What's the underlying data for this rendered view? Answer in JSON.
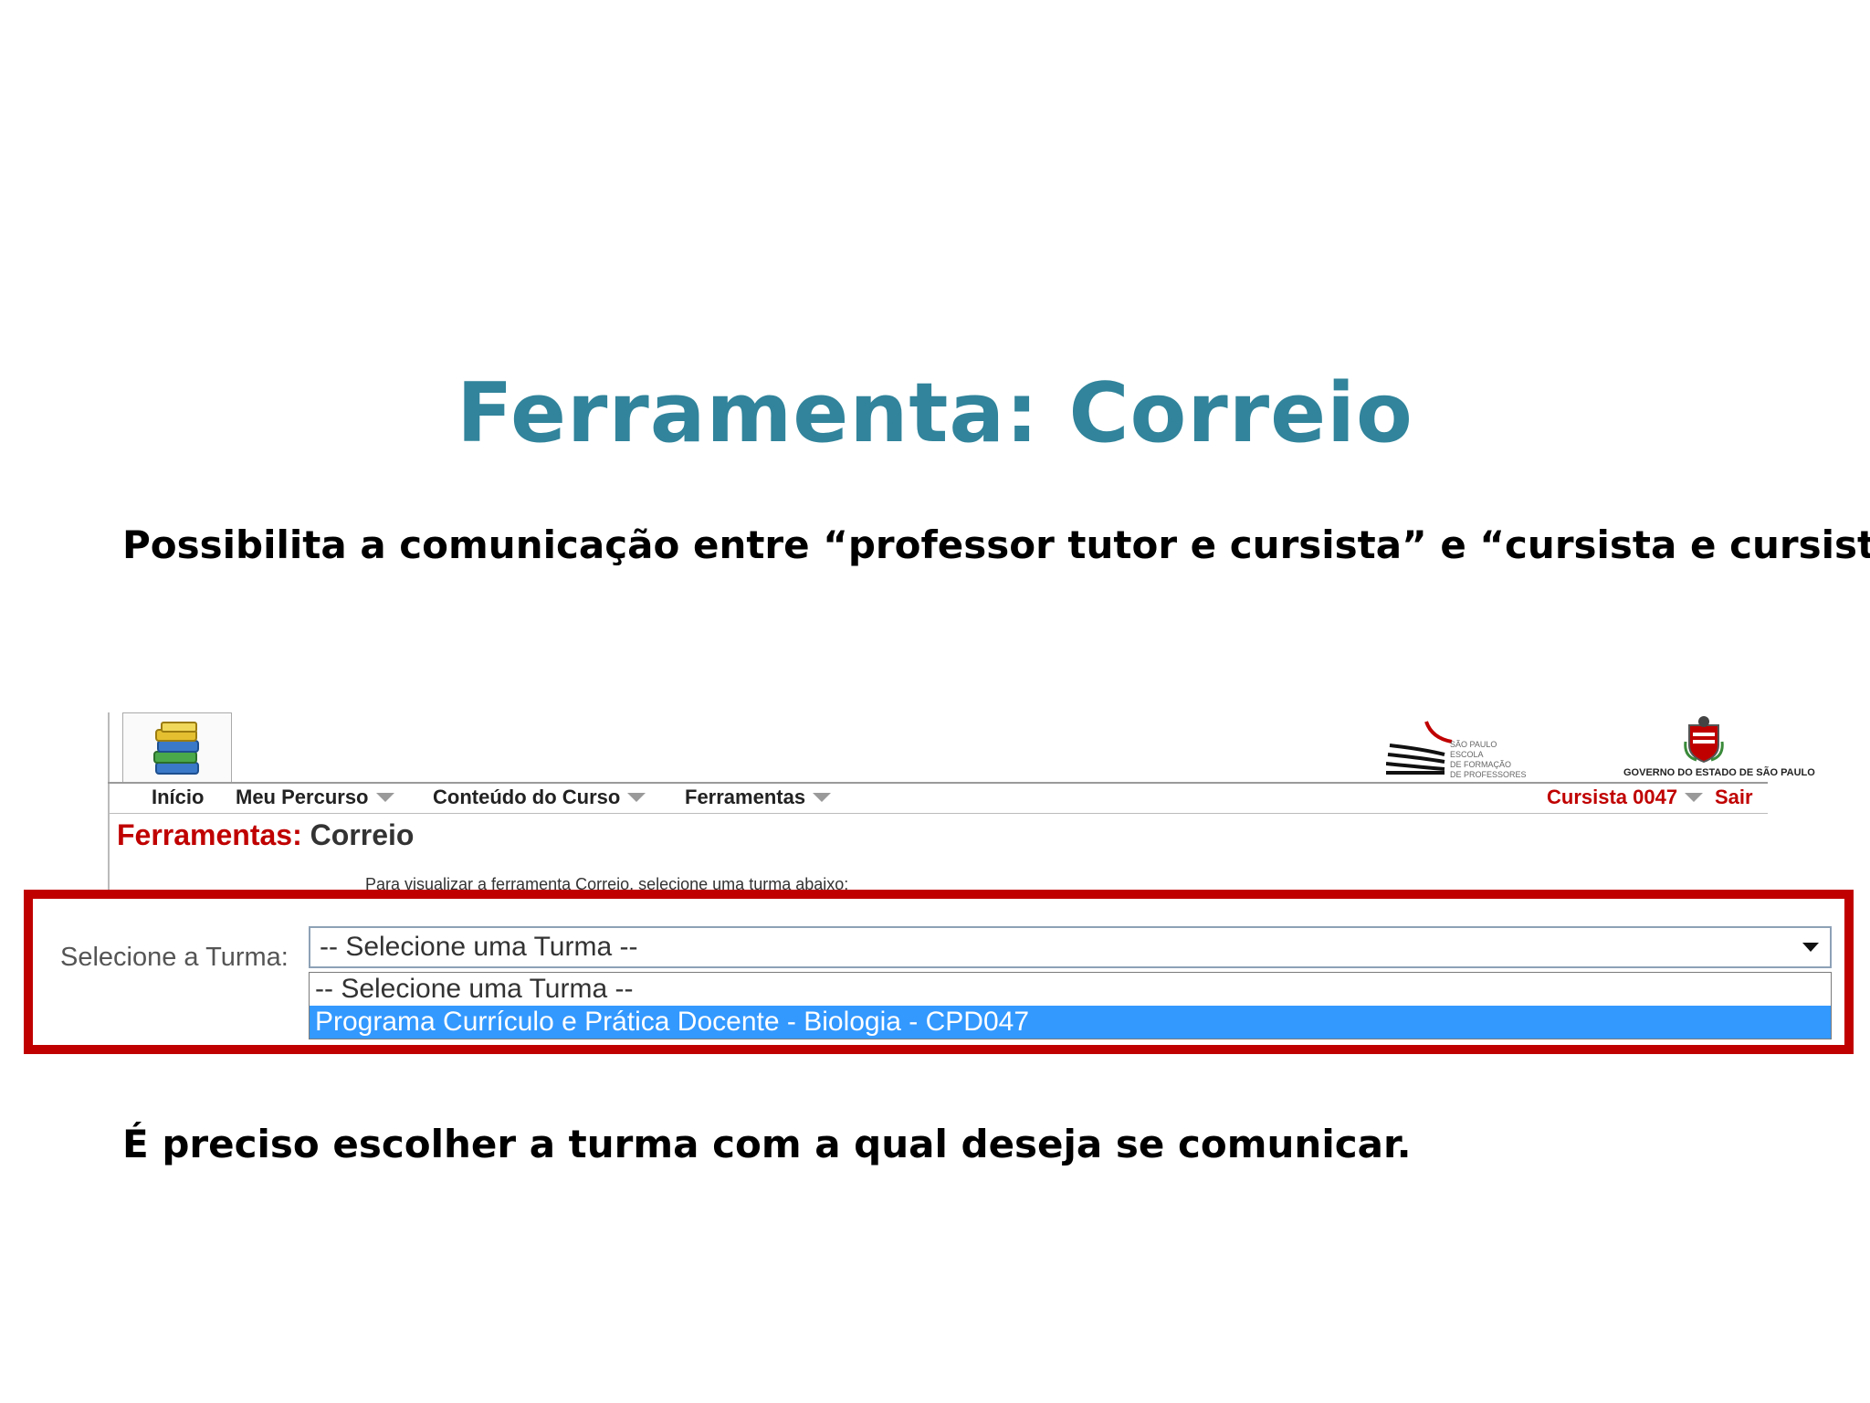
{
  "slide": {
    "title": "Ferramenta: Correio",
    "intro": "Possibilita a comunicação entre “professor tutor e cursista” e “cursista e cursista”.",
    "footer": "É preciso escolher a turma com a qual deseja se comunicar."
  },
  "logos": {
    "school_lines": [
      "SÃO PAULO ESCOLA",
      "DE FORMAÇÃO",
      "DE PROFESSORES"
    ],
    "government": "GOVERNO DO ESTADO DE SÃO PAULO"
  },
  "nav": {
    "home": "Início",
    "items": [
      "Meu Percurso",
      "Conteúdo do Curso",
      "Ferramentas"
    ],
    "user": "Cursista 0047",
    "logout": "Sair"
  },
  "page": {
    "title_prefix": "Ferramentas:",
    "title_suffix": "Correio",
    "instruction": "Para visualizar a ferramenta Correio, selecione uma turma abaixo:"
  },
  "form": {
    "label": "Selecione a Turma:",
    "selected": "-- Selecione uma Turma --",
    "options": [
      "-- Selecione uma Turma --",
      "Programa Currículo e Prática Docente - Biologia - CPD047"
    ],
    "highlighted_option": 1
  },
  "colors": {
    "title": "#31849b",
    "brand_red": "#c00000",
    "highlight_option": "#3399ff"
  }
}
